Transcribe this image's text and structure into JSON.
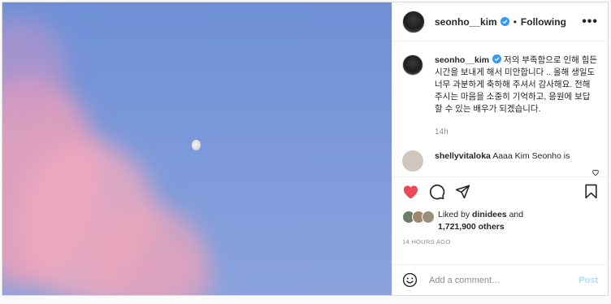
{
  "post": {
    "username": "seonho__kim",
    "follow_status": "Following",
    "separator": "•",
    "more": "•••",
    "caption_username": "seonho__kim",
    "caption": "저의 부족함으로 인해 힘든 시간을 보내게 해서 미안합니다 .. 올해 생일도 너무 과분하게 축하해 주셔서 감사해요. 전해주시는 마음을 소중히 기억하고, 응원에 보답할 수 있는 배우가 되겠습니다.",
    "caption_age": "14h",
    "comment": {
      "username": "shellyvitaloka",
      "text": "Aaaa Kim Seonho is"
    },
    "likes": {
      "prefix": "Liked by",
      "liked_by_user": "dinidees",
      "and": "and",
      "others": "1,721,900 others"
    },
    "timestamp": "14 HOURS AGO",
    "add_comment_placeholder": "Add a comment…",
    "post_button": "Post"
  },
  "colors": {
    "like_red": "#ed4956",
    "verified_blue": "#3897f0",
    "post_disabled": "#b3dbff",
    "sky_blue": "#7b98da",
    "cloud_pink": "#e2a3b8"
  },
  "icons": {
    "heart": "heart-filled-icon",
    "comment": "comment-icon",
    "share": "share-icon",
    "save": "bookmark-icon",
    "emoji": "emoji-icon",
    "small_heart": "heart-outline-icon",
    "verified": "verified-badge-icon"
  }
}
